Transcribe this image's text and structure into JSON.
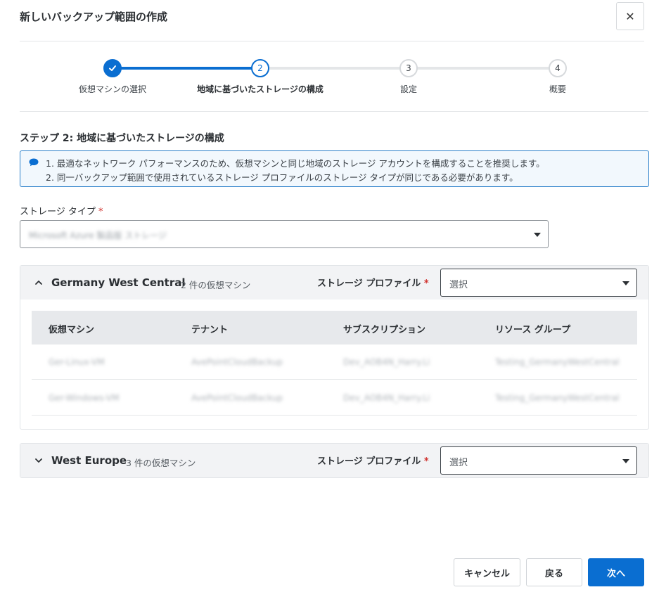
{
  "dialog": {
    "title": "新しいバックアップ範囲の作成",
    "close_label": "✕"
  },
  "stepper": {
    "steps": [
      {
        "number": "1",
        "label": "仮想マシンの選択",
        "state": "completed"
      },
      {
        "number": "2",
        "label": "地域に基づいたストレージの構成",
        "state": "active"
      },
      {
        "number": "3",
        "label": "設定",
        "state": "pending"
      },
      {
        "number": "4",
        "label": "概要",
        "state": "pending"
      }
    ]
  },
  "step_heading": "ステップ 2: 地域に基づいたストレージの構成",
  "info": {
    "lines": [
      "1. 最適なネットワーク パフォーマンスのため、仮想マシンと同じ地域のストレージ アカウントを構成することを推奨します。",
      "2. 同一バックアップ範囲で使用されているストレージ プロファイルのストレージ タイプが同じである必要があります。"
    ]
  },
  "storage_type": {
    "label": "ストレージ タイプ",
    "required_mark": "*",
    "value": "Microsoft Azure 製品版 ストレージ"
  },
  "regions": [
    {
      "name": "Germany West Central",
      "count": "2 件の仮想マシン",
      "expanded": true,
      "profile_label": "ストレージ プロファイル",
      "required_mark": "*",
      "profile_value": "選択",
      "table": {
        "headers": [
          "仮想マシン",
          "テナント",
          "サブスクリプション",
          "リソース グループ"
        ],
        "rows": [
          [
            "Ger-Linux-VM",
            "AvePointCloudBackup",
            "Dev_AOB4N_Harry.Li",
            "Testing_GermanyWestCentral"
          ],
          [
            "Ger-Windows-VM",
            "AvePointCloudBackup",
            "Dev_AOB4N_Harry.Li",
            "Testing_GermanyWestCentral"
          ]
        ]
      }
    },
    {
      "name": "West Europe",
      "count": "3 件の仮想マシン",
      "expanded": false,
      "profile_label": "ストレージ プロファイル",
      "required_mark": "*",
      "profile_value": "選択"
    }
  ],
  "footer": {
    "cancel": "キャンセル",
    "back": "戻る",
    "next": "次へ"
  },
  "colors": {
    "primary": "#0a6ed1",
    "required": "#d0312d",
    "info_border": "#2a7fc9"
  }
}
